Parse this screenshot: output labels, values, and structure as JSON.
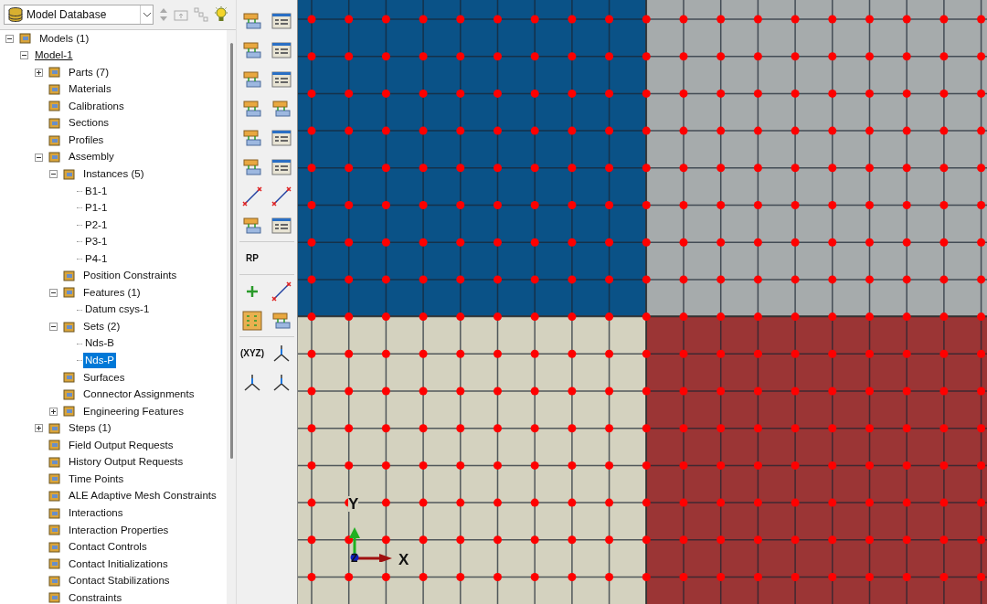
{
  "model_selector": {
    "value": "Model Database"
  },
  "tree": [
    {
      "label": "Models (1)",
      "kind": "node",
      "expanded": true,
      "selected": false,
      "children": [
        {
          "label": "Model-1",
          "kind": "current",
          "expanded": true,
          "selected": false,
          "children": [
            {
              "label": "Parts (7)",
              "kind": "node",
              "expanded": false,
              "selected": false
            },
            {
              "label": "Materials",
              "kind": "node",
              "selected": false
            },
            {
              "label": "Calibrations",
              "kind": "node",
              "selected": false
            },
            {
              "label": "Sections",
              "kind": "node",
              "selected": false
            },
            {
              "label": "Profiles",
              "kind": "node",
              "selected": false
            },
            {
              "label": "Assembly",
              "kind": "node",
              "expanded": true,
              "selected": false,
              "children": [
                {
                  "label": "Instances (5)",
                  "kind": "node",
                  "expanded": true,
                  "selected": false,
                  "children": [
                    {
                      "label": "B1-1",
                      "kind": "leaf",
                      "selected": false
                    },
                    {
                      "label": "P1-1",
                      "kind": "leaf",
                      "selected": false
                    },
                    {
                      "label": "P2-1",
                      "kind": "leaf",
                      "selected": false
                    },
                    {
                      "label": "P3-1",
                      "kind": "leaf",
                      "selected": false
                    },
                    {
                      "label": "P4-1",
                      "kind": "leaf",
                      "selected": false
                    }
                  ]
                },
                {
                  "label": "Position Constraints",
                  "kind": "node",
                  "selected": false
                },
                {
                  "label": "Features (1)",
                  "kind": "node",
                  "expanded": true,
                  "selected": false,
                  "children": [
                    {
                      "label": "Datum csys-1",
                      "kind": "leaf",
                      "selected": false
                    }
                  ]
                },
                {
                  "label": "Sets (2)",
                  "kind": "node",
                  "expanded": true,
                  "selected": false,
                  "children": [
                    {
                      "label": "Nds-B",
                      "kind": "leaf",
                      "selected": false
                    },
                    {
                      "label": "Nds-P",
                      "kind": "leaf",
                      "selected": true
                    }
                  ]
                },
                {
                  "label": "Surfaces",
                  "kind": "node",
                  "selected": false
                },
                {
                  "label": "Connector Assignments",
                  "kind": "node",
                  "selected": false
                },
                {
                  "label": "Engineering Features",
                  "kind": "node",
                  "expanded": false,
                  "selected": false
                }
              ]
            },
            {
              "label": "Steps (1)",
              "kind": "node",
              "expanded": false,
              "selected": false
            },
            {
              "label": "Field Output Requests",
              "kind": "node",
              "selected": false
            },
            {
              "label": "History Output Requests",
              "kind": "node",
              "selected": false
            },
            {
              "label": "Time Points",
              "kind": "node",
              "selected": false
            },
            {
              "label": "ALE Adaptive Mesh Constraints",
              "kind": "node",
              "selected": false
            },
            {
              "label": "Interactions",
              "kind": "node",
              "selected": false
            },
            {
              "label": "Interaction Properties",
              "kind": "node",
              "selected": false
            },
            {
              "label": "Contact Controls",
              "kind": "node",
              "selected": false
            },
            {
              "label": "Contact Initializations",
              "kind": "node",
              "selected": false
            },
            {
              "label": "Contact Stabilizations",
              "kind": "node",
              "selected": false
            },
            {
              "label": "Constraints",
              "kind": "node",
              "selected": false
            }
          ]
        }
      ]
    }
  ],
  "toolbox": [
    [
      {
        "kind": "tool"
      },
      {
        "kind": "window"
      },
      {
        "kind": "tool"
      },
      {
        "kind": "window"
      },
      {
        "kind": "tool"
      },
      {
        "kind": "window"
      },
      {
        "kind": "tool"
      },
      {
        "kind": "tool"
      },
      {
        "kind": "tool"
      },
      {
        "kind": "window"
      },
      {
        "kind": "tool"
      },
      {
        "kind": "window"
      },
      {
        "kind": "line"
      },
      {
        "kind": "line"
      },
      {
        "kind": "tool"
      },
      {
        "kind": "window"
      }
    ],
    [
      {
        "kind": "text",
        "label": "RP"
      }
    ],
    [
      {
        "kind": "plus"
      },
      {
        "kind": "line"
      },
      {
        "kind": "grid"
      },
      {
        "kind": "tool"
      }
    ],
    [
      {
        "kind": "text",
        "label": "(XYZ)"
      },
      {
        "kind": "axes"
      },
      {
        "kind": "axes"
      },
      {
        "kind": "axes"
      }
    ]
  ],
  "viewport": {
    "triad": {
      "x_label": "X",
      "y_label": "Y",
      "z_label": "Z"
    }
  }
}
